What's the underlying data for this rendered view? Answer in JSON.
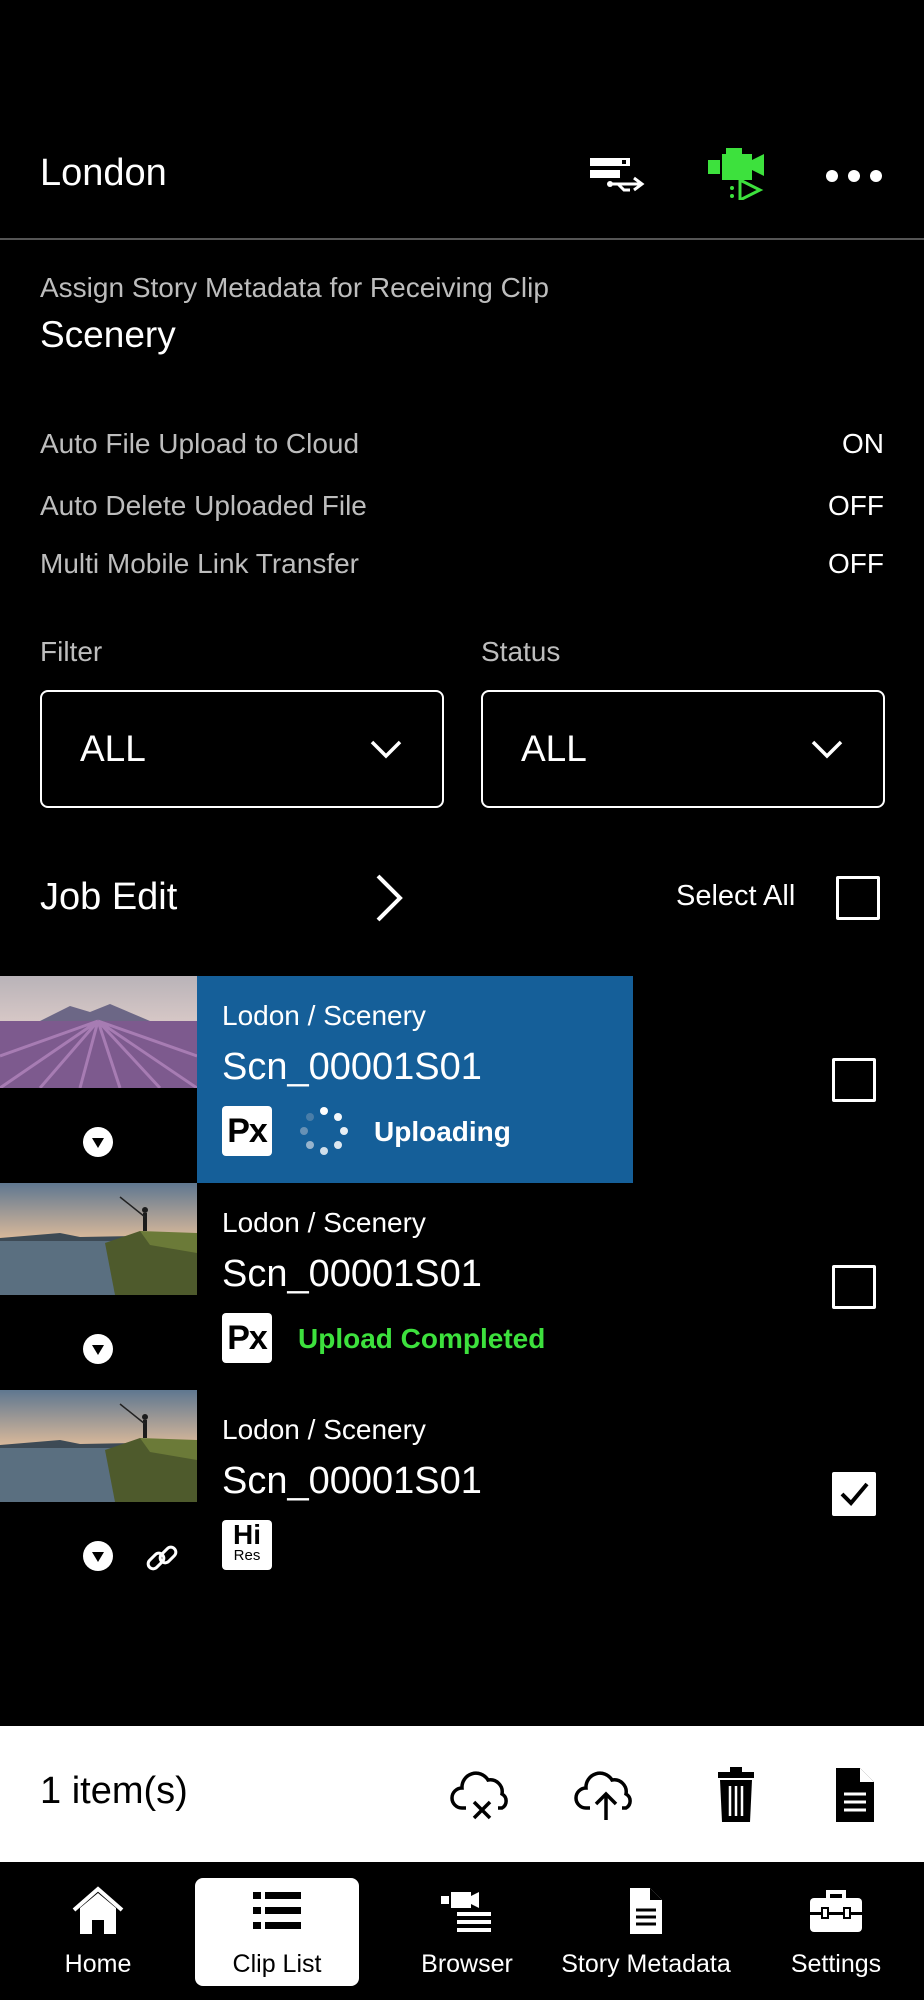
{
  "header": {
    "title": "London",
    "icons": [
      "usb-transfer-icon",
      "camera-stream-icon",
      "more-options-icon"
    ],
    "camera_icon_color": "#3de13d"
  },
  "assign": {
    "label": "Assign Story Metadata for Receiving Clip",
    "value": "Scenery"
  },
  "settings": [
    {
      "label": "Auto File Upload to Cloud",
      "value": "ON"
    },
    {
      "label": "Auto Delete Uploaded File",
      "value": "OFF"
    },
    {
      "label": "Multi Mobile Link Transfer",
      "value": "OFF"
    }
  ],
  "filter": {
    "label": "Filter",
    "value": "ALL"
  },
  "status_filter": {
    "label": "Status",
    "value": "ALL"
  },
  "job_edit": {
    "label": "Job Edit"
  },
  "select_all": {
    "label": "Select All",
    "checked": false
  },
  "clips": [
    {
      "path": "Lodon / Scenery",
      "name": "Scn_00001S01",
      "badge": "Px",
      "status": "Uploading",
      "status_color": "#ffffff",
      "selected": false,
      "active": true
    },
    {
      "path": "Lodon / Scenery",
      "name": "Scn_00001S01",
      "badge": "Px",
      "status": "Upload Completed",
      "status_color": "#3de13d",
      "selected": false,
      "active": false
    },
    {
      "path": "Lodon / Scenery",
      "name": "Scn_00001S01",
      "badge": "Hi",
      "badge_sub": "Res",
      "status": "",
      "selected": true,
      "active": false,
      "linked": true
    }
  ],
  "bottom_bar": {
    "count": "1 item(s)",
    "actions": [
      "cloud-cancel-icon",
      "cloud-upload-icon",
      "trash-icon",
      "document-icon"
    ]
  },
  "tabs": [
    {
      "label": "Home",
      "icon": "home-icon",
      "active": false
    },
    {
      "label": "Clip List",
      "icon": "list-icon",
      "active": true
    },
    {
      "label": "Browser",
      "icon": "browser-icon",
      "active": false
    },
    {
      "label": "Story Metadata",
      "icon": "document-icon",
      "active": false
    },
    {
      "label": "Settings",
      "icon": "toolbox-icon",
      "active": false
    }
  ],
  "colors": {
    "accent_blue": "#155f99",
    "success_green": "#3de13d",
    "background": "#000000"
  }
}
